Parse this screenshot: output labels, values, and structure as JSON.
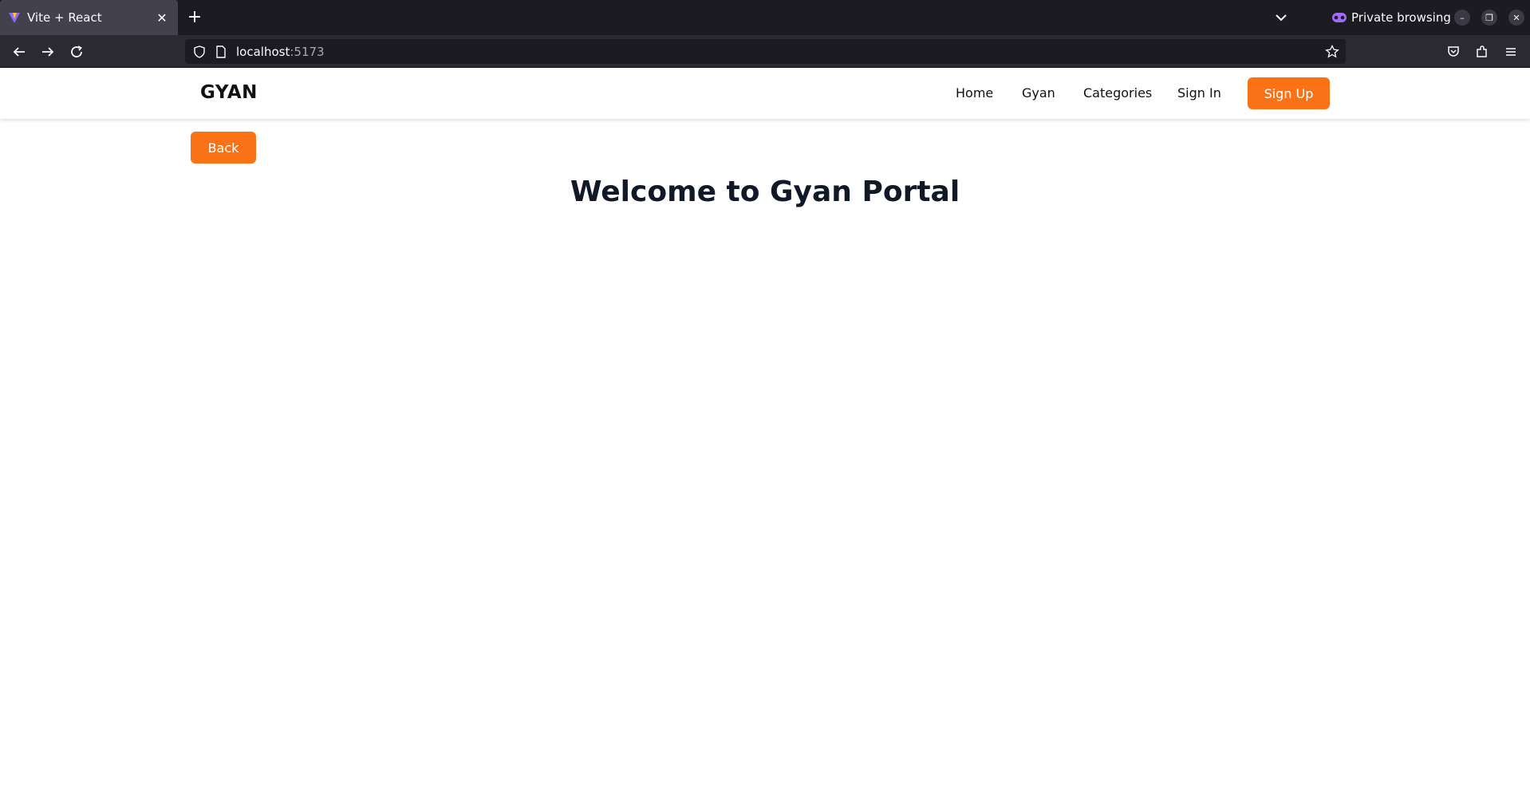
{
  "browser": {
    "tab_title": "Vite + React",
    "private_label": "Private browsing",
    "url_host": "localhost",
    "url_port": ":5173"
  },
  "site": {
    "brand": "GYAN",
    "nav": {
      "home": "Home",
      "gyan": "Gyan",
      "categories": "Categories",
      "signin": "Sign In",
      "signup": "Sign Up"
    },
    "back_label": "Back",
    "title": "Welcome to Gyan Portal"
  },
  "colors": {
    "accent": "#f97316",
    "title": "#111827",
    "chrome_dark": "#1c1b22",
    "chrome_toolbar": "#2b2a33"
  }
}
